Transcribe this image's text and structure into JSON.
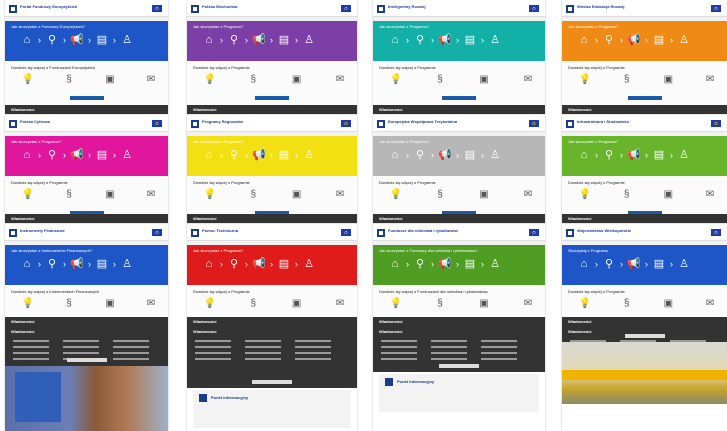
{
  "screens": [
    {
      "logo": "Portal Funduszy Europejskich",
      "hero_title": "Jak skorzystać z Funduszy Europejskich?",
      "find_title": "Dowiedz się więcej o Funduszach Europejskich",
      "accent": "#1e56c8"
    },
    {
      "logo": "Polska Wschodnia",
      "hero_title": "Jak skorzystać z Programu?",
      "find_title": "Dowiedz się więcej o Programie",
      "accent": "#7b3fa7"
    },
    {
      "logo": "Inteligentny Rozwój",
      "hero_title": "Jak skorzystać z Programu?",
      "find_title": "Dowiedz się więcej o Programie",
      "accent": "#12b0a6"
    },
    {
      "logo": "Wiedza Edukacja Rozwój",
      "hero_title": "Jak skorzystać z Programu?",
      "find_title": "Dowiedz się więcej o Programie",
      "accent": "#f08a16"
    },
    {
      "logo": "Polska Cyfrowa",
      "hero_title": "Jak skorzystać z Programu?",
      "find_title": "Dowiedz się więcej o Programie",
      "accent": "#e0169c"
    },
    {
      "logo": "Programy Regionalne",
      "hero_title": "Jak skorzystać z Programu?",
      "find_title": "Dowiedz się więcej o Programie",
      "accent": "#f2e012"
    },
    {
      "logo": "Europejska Współpraca Terytorialna",
      "hero_title": "Jak skorzystać z Programu?",
      "find_title": "Dowiedz się więcej o Programie",
      "accent": "#b7b7b7"
    },
    {
      "logo": "Infrastruktura i Środowisko",
      "hero_title": "Jak skorzystać z Programu?",
      "find_title": "Dowiedz się więcej o Programie",
      "accent": "#68b52c"
    },
    {
      "logo": "Instrumenty Finansowe",
      "hero_title": "Jak skorzystać z Instrumentów Finansowych?",
      "find_title": "Dowiedz się więcej o Instrumentach Finansowych",
      "accent": "#1e56c8"
    },
    {
      "logo": "Pomoc Techniczna",
      "hero_title": "Jak skorzystać z Programu?",
      "find_title": "Dowiedz się więcej o Programie",
      "accent": "#e01b1b"
    },
    {
      "logo": "Fundusze dla rolnictwa i rybołówstwa",
      "hero_title": "Jak skorzystać z Funduszy dla rolnictwa i rybołówstwa?",
      "find_title": "Dowiedz się więcej o Funduszach dla rolnictwa i rybołówstwa",
      "accent": "#4f9e23"
    },
    {
      "logo": "Województwo Wielkopolskie",
      "hero_title": "Skorzystaj z Programu",
      "find_title": "Dowiedz się więcej o Programie",
      "accent": "#1e56c8"
    }
  ],
  "news_heading": "Wiadomości",
  "info_point_title": "Punkt Informacyjny",
  "dark_band": "#333333",
  "icons": {
    "hero_steps": [
      "house-icon",
      "magnifier-icon",
      "megaphone-icon",
      "document-icon",
      "person-icon"
    ],
    "find": [
      "lightbulb-icon",
      "paragraph-icon",
      "presentation-icon",
      "mail-icon"
    ]
  }
}
